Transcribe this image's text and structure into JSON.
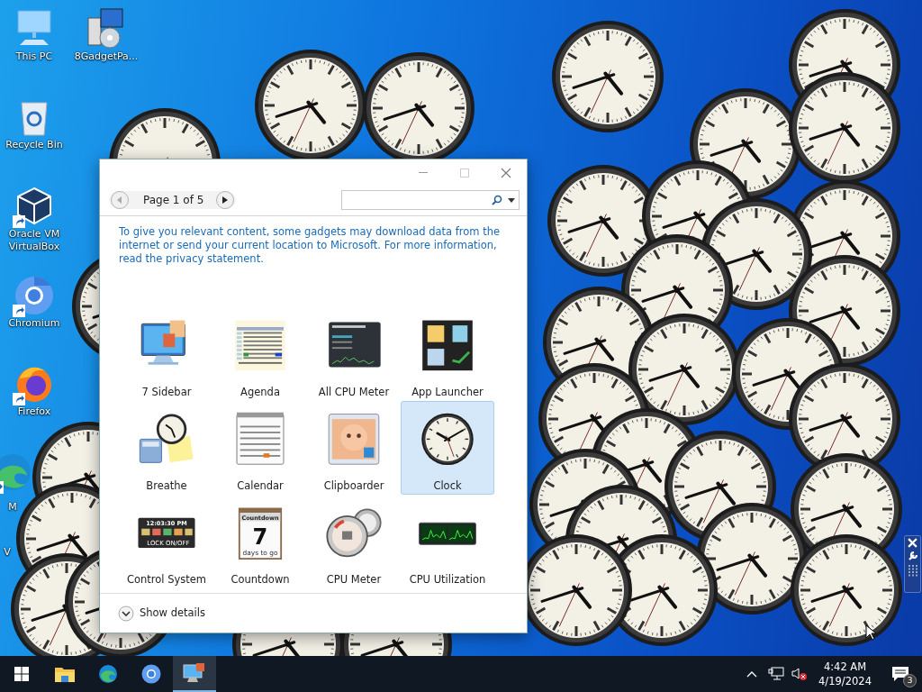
{
  "desktop_icons": [
    {
      "kind": "pc",
      "label": "This PC",
      "shortcut": false
    },
    {
      "kind": "installer",
      "label": "8GadgetPa...",
      "shortcut": false
    },
    {
      "kind": "recycle",
      "label": "Recycle Bin",
      "shortcut": false
    },
    {
      "kind": "virtualbox",
      "label": "Oracle VM VirtualBox",
      "shortcut": true
    },
    {
      "kind": "chromium",
      "label": "Chromium",
      "shortcut": true
    },
    {
      "kind": "firefox",
      "label": "Firefox",
      "shortcut": true
    },
    {
      "kind": "edge",
      "label": "M",
      "shortcut": true
    },
    {
      "kind": "blank",
      "label": "V"
    }
  ],
  "gadget_window": {
    "pager": "Page 1 of 5",
    "notice": "To give you relevant content, some gadgets may download data from the internet or send your current location to Microsoft. For more information, read the privacy statement.",
    "gadgets": [
      {
        "kind": "sidebar",
        "name": "7 Sidebar",
        "selected": false
      },
      {
        "kind": "agenda",
        "name": "Agenda",
        "selected": false
      },
      {
        "kind": "cpu-panel",
        "name": "All CPU Meter",
        "selected": false
      },
      {
        "kind": "launcher",
        "name": "App Launcher",
        "selected": false
      },
      {
        "kind": "breathe",
        "name": "Breathe",
        "selected": false
      },
      {
        "kind": "calendar",
        "name": "Calendar",
        "selected": false
      },
      {
        "kind": "clipboarder",
        "name": "Clipboarder",
        "selected": false
      },
      {
        "kind": "clock",
        "name": "Clock",
        "selected": true
      },
      {
        "kind": "control",
        "name": "Control System",
        "selected": false,
        "thumb_text": [
          "12:03:30 PM",
          "LOCK ON/OFF"
        ]
      },
      {
        "kind": "countdown",
        "name": "Countdown",
        "selected": false,
        "thumb_text": [
          "Countdown",
          "7",
          "days to go"
        ]
      },
      {
        "kind": "gauge",
        "name": "CPU Meter",
        "selected": false
      },
      {
        "kind": "graph",
        "name": "CPU Utilization",
        "selected": false
      }
    ],
    "details_toggle": "Show details"
  },
  "taskbar": {
    "apps": [
      {
        "kind": "explorer",
        "active": false
      },
      {
        "kind": "edge",
        "active": false
      },
      {
        "kind": "chromium",
        "active": false
      },
      {
        "kind": "gadgets",
        "active": true
      }
    ],
    "time": "4:42 AM",
    "date": "4/19/2024",
    "notifications": "3"
  }
}
